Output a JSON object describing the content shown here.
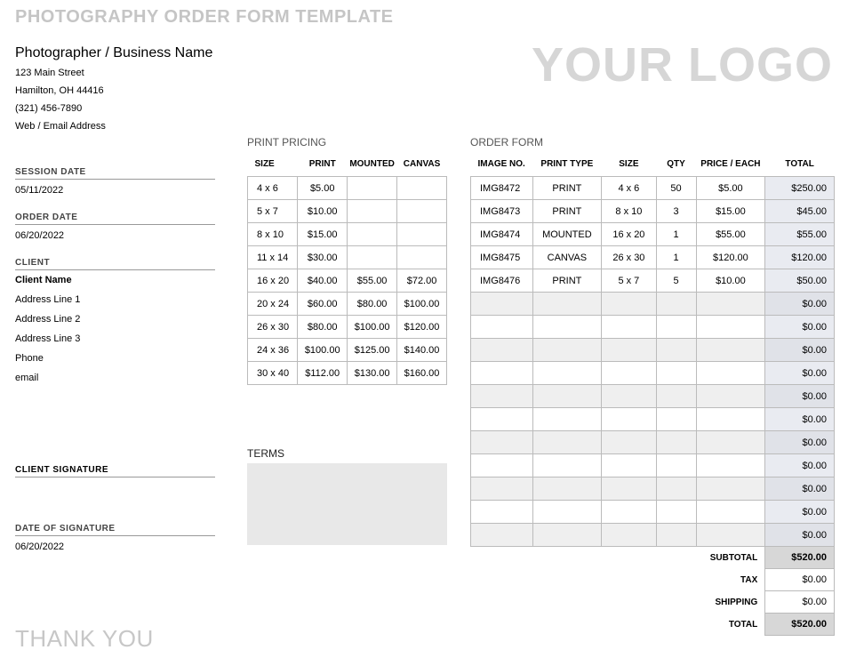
{
  "title": "PHOTOGRAPHY ORDER FORM TEMPLATE",
  "logo": "YOUR LOGO",
  "business": {
    "name": "Photographer / Business Name",
    "address": "123 Main Street",
    "city": "Hamilton, OH 44416",
    "phone": "(321) 456-7890",
    "web": "Web / Email Address"
  },
  "fields": {
    "session_date_label": "SESSION DATE",
    "session_date": "05/11/2022",
    "order_date_label": "ORDER DATE",
    "order_date": "06/20/2022",
    "client_label": "CLIENT",
    "client": {
      "name": "Client Name",
      "a1": "Address Line 1",
      "a2": "Address Line 2",
      "a3": "Address Line 3",
      "phone": "Phone",
      "email": "email"
    },
    "sig_label": "CLIENT SIGNATURE",
    "sig_date_label": "DATE OF SIGNATURE",
    "sig_date": "06/20/2022"
  },
  "pricing": {
    "title": "PRINT PRICING",
    "headers": [
      "SIZE",
      "PRINT",
      "MOUNTED",
      "CANVAS"
    ],
    "rows": [
      {
        "size": "4 x 6",
        "print": "$5.00",
        "mounted": "",
        "canvas": ""
      },
      {
        "size": "5 x 7",
        "print": "$10.00",
        "mounted": "",
        "canvas": ""
      },
      {
        "size": "8 x 10",
        "print": "$15.00",
        "mounted": "",
        "canvas": ""
      },
      {
        "size": "11 x 14",
        "print": "$30.00",
        "mounted": "",
        "canvas": ""
      },
      {
        "size": "16 x 20",
        "print": "$40.00",
        "mounted": "$55.00",
        "canvas": "$72.00"
      },
      {
        "size": "20 x 24",
        "print": "$60.00",
        "mounted": "$80.00",
        "canvas": "$100.00"
      },
      {
        "size": "26 x 30",
        "print": "$80.00",
        "mounted": "$100.00",
        "canvas": "$120.00"
      },
      {
        "size": "24 x 36",
        "print": "$100.00",
        "mounted": "$125.00",
        "canvas": "$140.00"
      },
      {
        "size": "30 x 40",
        "print": "$112.00",
        "mounted": "$130.00",
        "canvas": "$160.00"
      }
    ]
  },
  "order": {
    "title": "ORDER FORM",
    "headers": [
      "IMAGE NO.",
      "PRINT TYPE",
      "SIZE",
      "QTY",
      "PRICE / EACH",
      "TOTAL"
    ],
    "rows": [
      {
        "img": "IMG8472",
        "type": "PRINT",
        "size": "4 x 6",
        "qty": "50",
        "price": "$5.00",
        "total": "$250.00"
      },
      {
        "img": "IMG8473",
        "type": "PRINT",
        "size": "8 x 10",
        "qty": "3",
        "price": "$15.00",
        "total": "$45.00"
      },
      {
        "img": "IMG8474",
        "type": "MOUNTED",
        "size": "16 x 20",
        "qty": "1",
        "price": "$55.00",
        "total": "$55.00"
      },
      {
        "img": "IMG8475",
        "type": "CANVAS",
        "size": "26 x 30",
        "qty": "1",
        "price": "$120.00",
        "total": "$120.00"
      },
      {
        "img": "IMG8476",
        "type": "PRINT",
        "size": "5 x 7",
        "qty": "5",
        "price": "$10.00",
        "total": "$50.00"
      },
      {
        "img": "",
        "type": "",
        "size": "",
        "qty": "",
        "price": "",
        "total": "$0.00"
      },
      {
        "img": "",
        "type": "",
        "size": "",
        "qty": "",
        "price": "",
        "total": "$0.00"
      },
      {
        "img": "",
        "type": "",
        "size": "",
        "qty": "",
        "price": "",
        "total": "$0.00"
      },
      {
        "img": "",
        "type": "",
        "size": "",
        "qty": "",
        "price": "",
        "total": "$0.00"
      },
      {
        "img": "",
        "type": "",
        "size": "",
        "qty": "",
        "price": "",
        "total": "$0.00"
      },
      {
        "img": "",
        "type": "",
        "size": "",
        "qty": "",
        "price": "",
        "total": "$0.00"
      },
      {
        "img": "",
        "type": "",
        "size": "",
        "qty": "",
        "price": "",
        "total": "$0.00"
      },
      {
        "img": "",
        "type": "",
        "size": "",
        "qty": "",
        "price": "",
        "total": "$0.00"
      },
      {
        "img": "",
        "type": "",
        "size": "",
        "qty": "",
        "price": "",
        "total": "$0.00"
      },
      {
        "img": "",
        "type": "",
        "size": "",
        "qty": "",
        "price": "",
        "total": "$0.00"
      },
      {
        "img": "",
        "type": "",
        "size": "",
        "qty": "",
        "price": "",
        "total": "$0.00"
      }
    ],
    "summary": {
      "subtotal_label": "SUBTOTAL",
      "subtotal": "$520.00",
      "tax_label": "TAX",
      "tax": "$0.00",
      "shipping_label": "SHIPPING",
      "shipping": "$0.00",
      "total_label": "TOTAL",
      "total": "$520.00"
    }
  },
  "terms_label": "TERMS",
  "thanks": "THANK YOU"
}
